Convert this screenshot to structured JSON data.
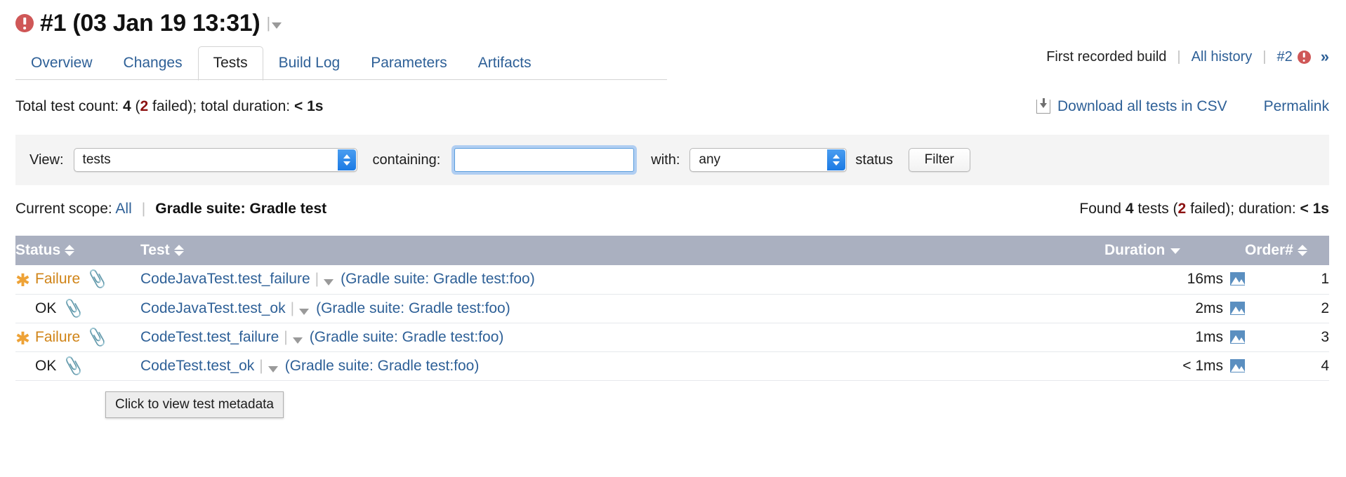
{
  "build": {
    "status_icon": "error-circle-icon",
    "title": "#1 (03 Jan 19 13:31)",
    "menu_caret": "caret-down-icon"
  },
  "tabs": [
    {
      "label": "Overview",
      "active": false
    },
    {
      "label": "Changes",
      "active": false
    },
    {
      "label": "Tests",
      "active": true
    },
    {
      "label": "Build Log",
      "active": false
    },
    {
      "label": "Parameters",
      "active": false
    },
    {
      "label": "Artifacts",
      "active": false
    }
  ],
  "history": {
    "first_build": "First recorded build",
    "all_history": "All history",
    "next_build": "#2",
    "next_build_status_icon": "error-circle-icon",
    "more": "»"
  },
  "summary": {
    "prefix": "Total test count:",
    "total": "4",
    "open_paren": "(",
    "failed_count": "2",
    "failed_word": "failed);",
    "duration_label": "total duration:",
    "duration_value": "< 1s",
    "download_csv": "Download all tests in CSV",
    "download_icon": "download-icon",
    "permalink": "Permalink"
  },
  "filter": {
    "view_label": "View:",
    "view_value": "tests",
    "view_options": [
      "tests"
    ],
    "containing_label": "containing:",
    "containing_value": "",
    "containing_placeholder": "",
    "with_label": "with:",
    "status_value": "any",
    "status_options": [
      "any"
    ],
    "status_label": "status",
    "filter_button": "Filter"
  },
  "scope": {
    "label": "Current scope:",
    "all_link": "All",
    "separator": "|",
    "current": "Gradle suite: Gradle test",
    "found_prefix": "Found",
    "found_count": "4",
    "found_word": "tests",
    "open_paren": "(",
    "failed_count": "2",
    "failed_word": "failed);",
    "duration_label": "duration:",
    "duration_value": "< 1s"
  },
  "table": {
    "columns": [
      {
        "label": "Status",
        "sort": "both"
      },
      {
        "label": "Test",
        "sort": "both"
      },
      {
        "label": "Duration",
        "sort": "desc"
      },
      {
        "label": "Order#",
        "sort": "both"
      }
    ],
    "rows": [
      {
        "status": "Failure",
        "status_kind": "fail",
        "status_icon": "asterisk-icon",
        "attachment_icon": "paperclip-icon",
        "test_name": "CodeJavaTest.test_failure",
        "name_caret": "caret-down-icon",
        "suite": "(Gradle suite: Gradle test:foo)",
        "duration": "16ms",
        "graph_icon": "chart-icon",
        "order": "1",
        "tooltip_covered": false
      },
      {
        "status": "OK",
        "status_kind": "ok",
        "status_icon": "none",
        "attachment_icon": "paperclip-icon",
        "test_name": "CodeJavaTest.test_ok",
        "name_caret": "caret-down-icon",
        "suite": "(Gradle suite: Gradle test:foo)",
        "duration": "2ms",
        "graph_icon": "chart-icon",
        "order": "2",
        "tooltip_covered": true
      },
      {
        "status": "Failure",
        "status_kind": "fail",
        "status_icon": "asterisk-icon",
        "attachment_icon": "paperclip-icon",
        "test_name": "CodeTest.test_failure",
        "name_caret": "caret-down-icon",
        "suite": "(Gradle suite: Gradle test:foo)",
        "duration": "1ms",
        "graph_icon": "chart-icon",
        "order": "3",
        "tooltip_covered": false
      },
      {
        "status": "OK",
        "status_kind": "ok",
        "status_icon": "none",
        "attachment_icon": "paperclip-icon",
        "test_name": "CodeTest.test_ok",
        "name_caret": "caret-down-icon",
        "suite": "(Gradle suite: Gradle test:foo)",
        "duration": "< 1ms",
        "graph_icon": "chart-icon",
        "order": "4",
        "tooltip_covered": false
      }
    ]
  },
  "tooltip": {
    "text": "Click to view test metadata"
  },
  "colors": {
    "link": "#2e6097",
    "error_red": "#cf5757",
    "failed_count_red": "#8c1111",
    "failure_orange": "#d08418",
    "asterisk_orange": "#eea236",
    "table_header_bg": "#aab0c0",
    "panel_bg": "#f4f4f4"
  }
}
